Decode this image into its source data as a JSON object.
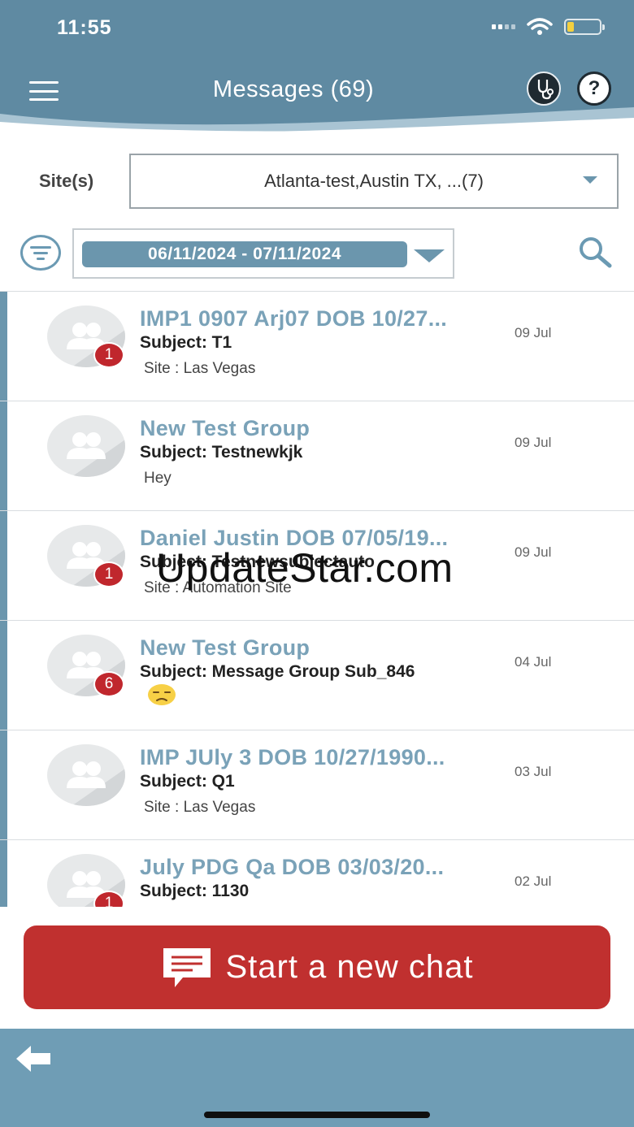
{
  "status_bar": {
    "time": "11:55",
    "battery_level": 0.2
  },
  "header": {
    "title": "Messages (69)",
    "help_label": "?"
  },
  "filters": {
    "site_label": "Site(s)",
    "site_value": "Atlanta-test,Austin TX, ...(7)",
    "date_range": "06/11/2024 - 07/11/2024"
  },
  "messages": [
    {
      "title": "IMP1 0907 Arj07 DOB 10/27...",
      "subject": "Subject: T1",
      "preview": "Site : Las Vegas",
      "date": "09 Jul",
      "badge": "1"
    },
    {
      "title": "New Test Group",
      "subject": "Subject: Testnewkjk",
      "preview": "Hey",
      "date": "09 Jul",
      "badge": ""
    },
    {
      "title": "Daniel Justin DOB 07/05/19...",
      "subject": "Subject: Testnewsubjectauto",
      "preview": "Site : Automation Site",
      "date": "09 Jul",
      "badge": "1"
    },
    {
      "title": "New Test Group",
      "subject": "Subject: Message Group Sub_846",
      "preview": "",
      "date": "04 Jul",
      "badge": "6",
      "preview_emoji": "unamused-face-emoji"
    },
    {
      "title": "IMP JUly 3 DOB 10/27/1990...",
      "subject": "Subject: Q1",
      "preview": "Site : Las Vegas",
      "date": "03 Jul",
      "badge": ""
    },
    {
      "title": "July PDG Qa DOB 03/03/20...",
      "subject": "Subject: 1130",
      "preview": "",
      "date": "02 Jul",
      "badge": "1"
    }
  ],
  "watermark": "UpdateStar.com",
  "start_chat_label": "Start a new chat",
  "colors": {
    "accent": "#6b96ad",
    "header": "#5f8aa2",
    "cta": "#c0302f",
    "badge": "#c0272d"
  }
}
